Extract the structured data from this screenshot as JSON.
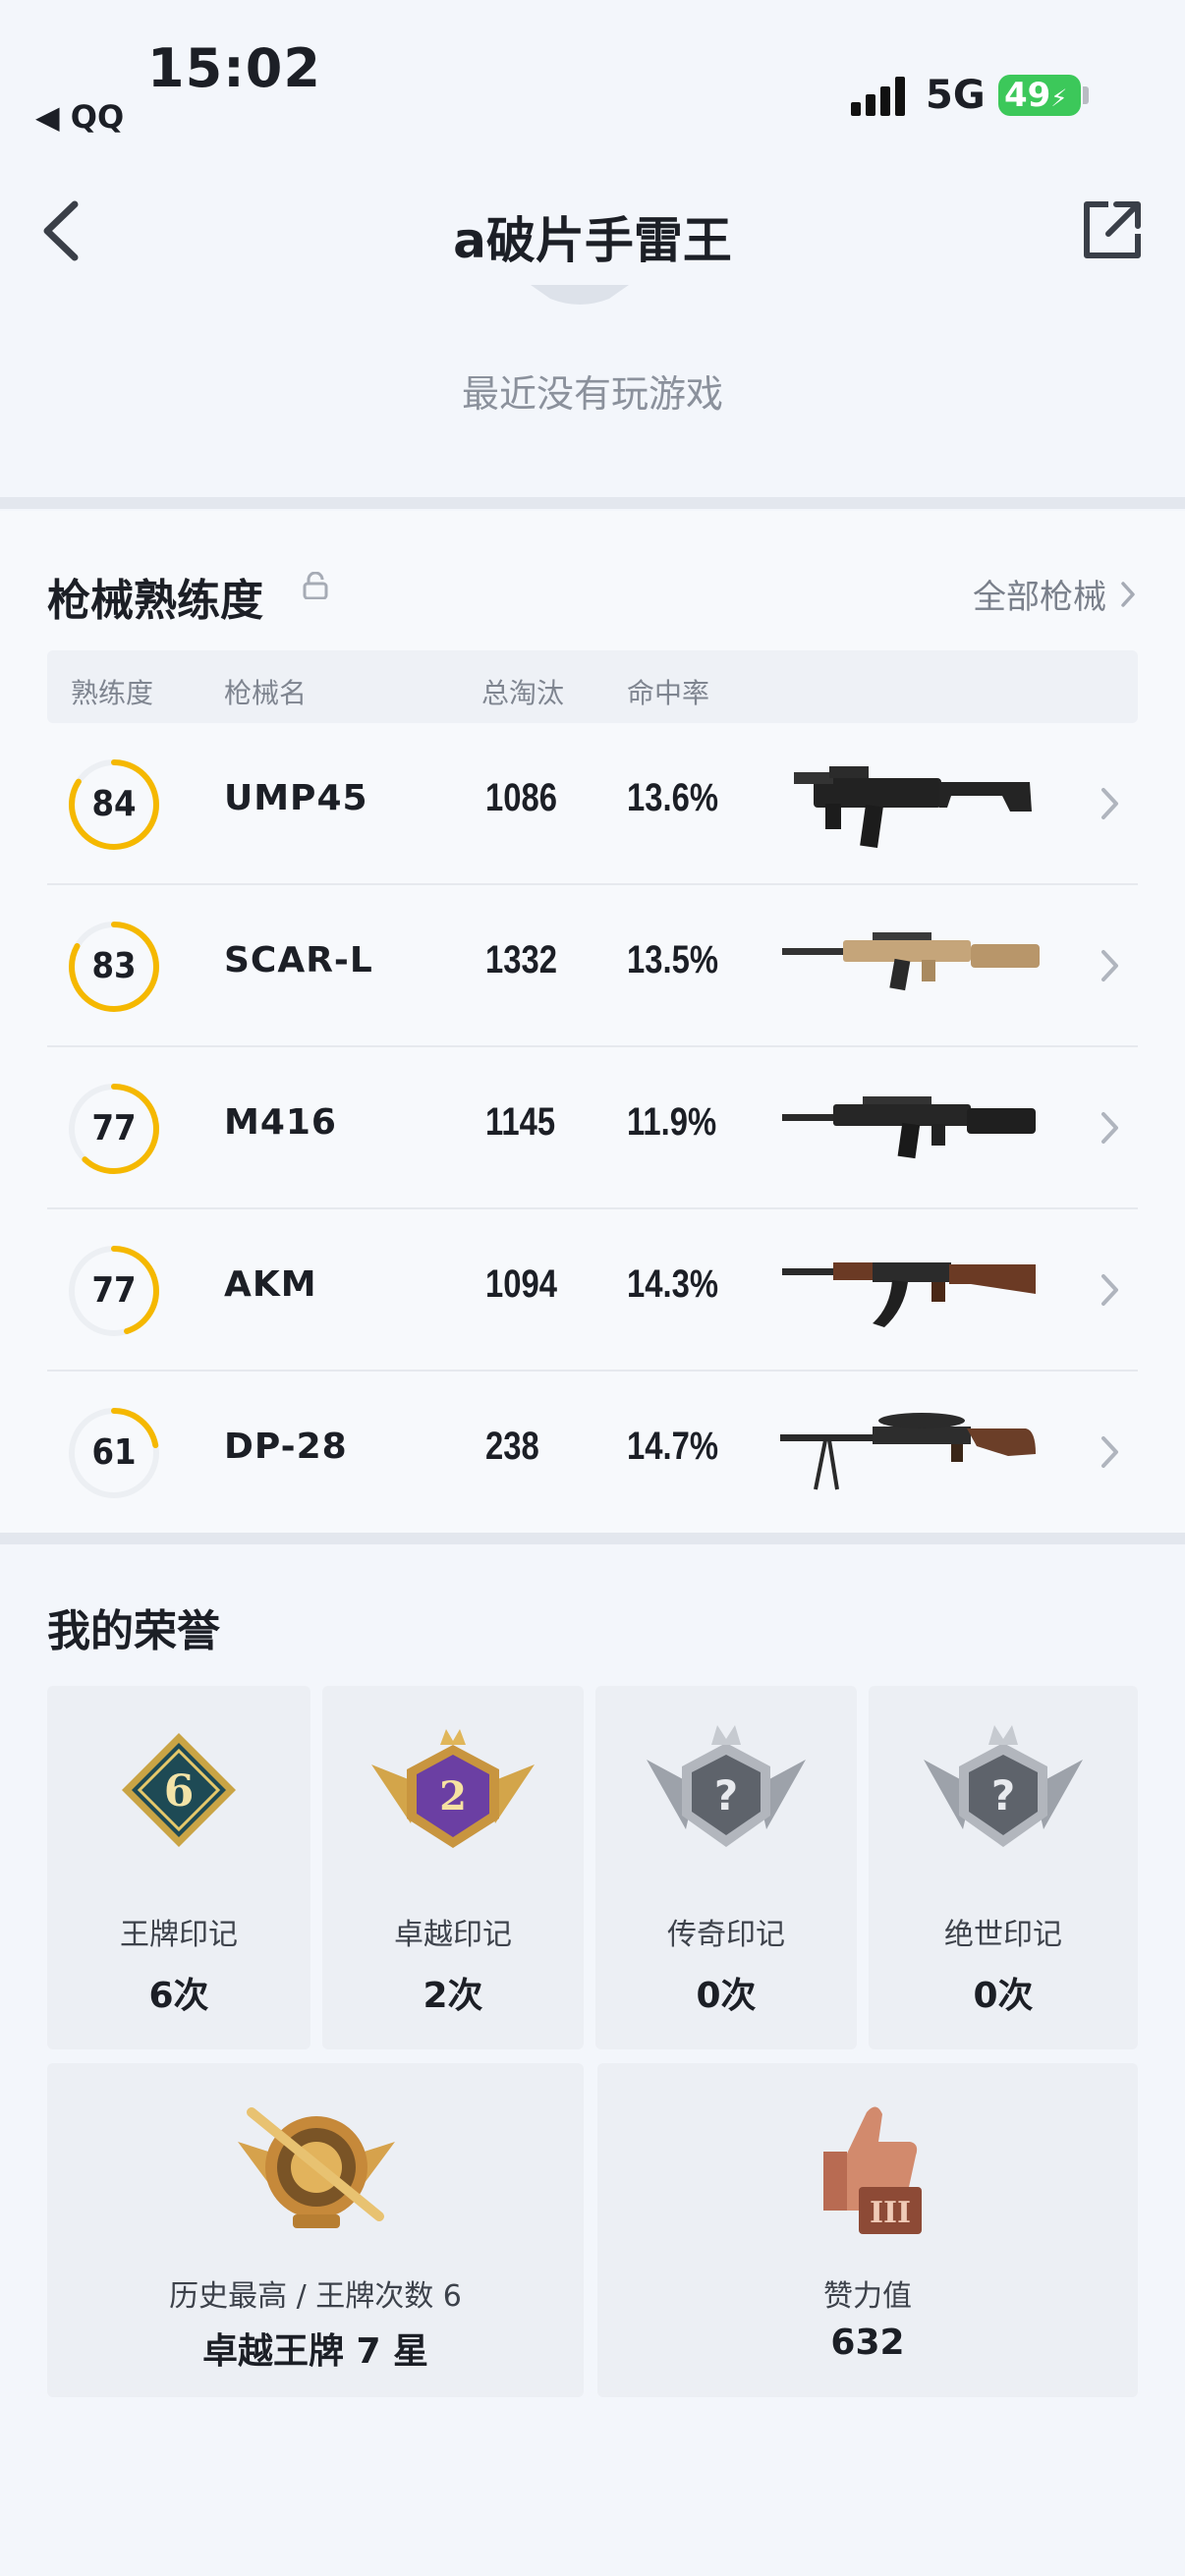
{
  "status_bar": {
    "time": "15:02",
    "back_app": "◀ QQ",
    "network": "5G",
    "battery": "49"
  },
  "nav": {
    "title": "a破片手雷王"
  },
  "profile": {
    "game_status": "最近没有玩游戏"
  },
  "weapons": {
    "title": "枪械熟练度",
    "see_all": "全部枪械",
    "columns": {
      "mastery": "熟练度",
      "name": "枪械名",
      "kills": "总淘汰",
      "hit_rate": "命中率"
    },
    "rows": [
      {
        "mastery": "84",
        "progress": 0.84,
        "name": "UMP45",
        "kills": "1086",
        "hit_rate": "13.6%",
        "icon": "smg-ump45-icon"
      },
      {
        "mastery": "83",
        "progress": 0.83,
        "name": "SCAR-L",
        "kills": "1332",
        "hit_rate": "13.5%",
        "icon": "rifle-scar-icon"
      },
      {
        "mastery": "77",
        "progress": 0.62,
        "name": "M416",
        "kills": "1145",
        "hit_rate": "11.9%",
        "icon": "rifle-m416-icon"
      },
      {
        "mastery": "77",
        "progress": 0.45,
        "name": "AKM",
        "kills": "1094",
        "hit_rate": "14.3%",
        "icon": "rifle-akm-icon"
      },
      {
        "mastery": "61",
        "progress": 0.22,
        "name": "DP-28",
        "kills": "238",
        "hit_rate": "14.7%",
        "icon": "lmg-dp28-icon"
      }
    ]
  },
  "honors": {
    "title": "我的荣誉",
    "marks": [
      {
        "label": "王牌印记",
        "count": "6次",
        "badge_text": "6",
        "icon": "ace-mark-badge"
      },
      {
        "label": "卓越印记",
        "count": "2次",
        "badge_text": "2",
        "icon": "excellence-mark-badge"
      },
      {
        "label": "传奇印记",
        "count": "0次",
        "badge_text": "?",
        "icon": "legend-mark-badge"
      },
      {
        "label": "绝世印记",
        "count": "0次",
        "badge_text": "?",
        "icon": "peerless-mark-badge"
      }
    ],
    "highest": {
      "label": "历史最高 / 王牌次数 6",
      "value": "卓越王牌 7 星",
      "icon": "tier-crest-badge"
    },
    "likes": {
      "label": "赞力值",
      "value": "632",
      "icon": "thumbs-up-trophy-icon"
    }
  },
  "colors": {
    "accent": "#f5b800",
    "ring_track": "#eceff3",
    "text_muted": "#7f8590"
  }
}
